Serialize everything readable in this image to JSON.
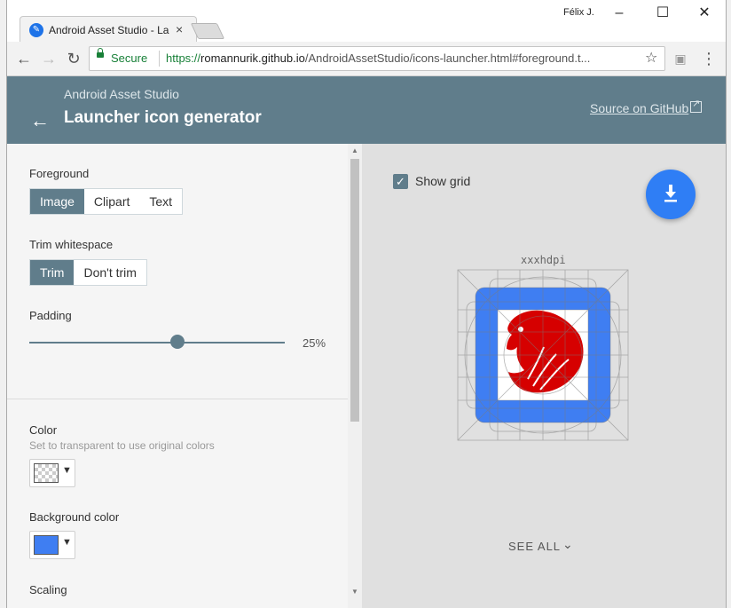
{
  "browser": {
    "tab_title": "Android Asset Studio - La",
    "user_name": "Félix J.",
    "secure_label": "Secure",
    "url_scheme": "https://",
    "url_host": "romannurik.github.io",
    "url_path": "/AndroidAssetStudio/icons-launcher.html#foreground.t..."
  },
  "header": {
    "eyebrow": "Android Asset Studio",
    "title": "Launcher icon generator",
    "source_link": "Source on GitHub"
  },
  "foreground": {
    "label": "Foreground",
    "options": [
      "Image",
      "Clipart",
      "Text"
    ],
    "selected": "Image"
  },
  "trim": {
    "label": "Trim whitespace",
    "options": [
      "Trim",
      "Don't trim"
    ],
    "selected": "Trim"
  },
  "padding": {
    "label": "Padding",
    "value": "25%"
  },
  "color": {
    "label": "Color",
    "hint": "Set to transparent to use original colors",
    "value_kind": "transparent"
  },
  "background_color": {
    "label": "Background color",
    "value": "#3f7ef2"
  },
  "scaling": {
    "label": "Scaling"
  },
  "preview": {
    "show_grid_label": "Show grid",
    "show_grid_checked": true,
    "density_label": "xxxhdpi",
    "see_all_label": "SEE ALL",
    "icon_bg": "#3f7ef2",
    "foreground_color": "#d60000"
  }
}
